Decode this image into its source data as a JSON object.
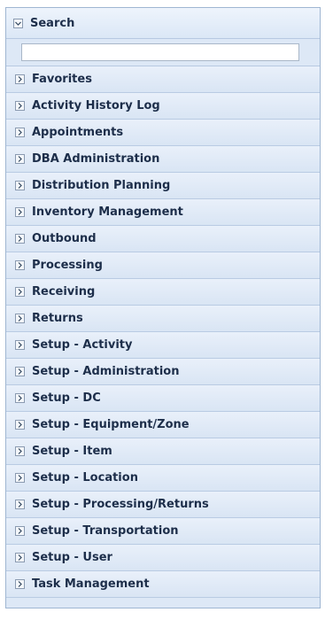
{
  "search": {
    "title": "Search",
    "input_value": "",
    "input_placeholder": ""
  },
  "menu": {
    "items": [
      {
        "label": "Favorites"
      },
      {
        "label": "Activity History Log"
      },
      {
        "label": "Appointments"
      },
      {
        "label": "DBA Administration"
      },
      {
        "label": "Distribution Planning"
      },
      {
        "label": "Inventory Management"
      },
      {
        "label": "Outbound"
      },
      {
        "label": "Processing"
      },
      {
        "label": "Receiving"
      },
      {
        "label": "Returns"
      },
      {
        "label": "Setup - Activity"
      },
      {
        "label": "Setup - Administration"
      },
      {
        "label": "Setup - DC"
      },
      {
        "label": "Setup - Equipment/Zone"
      },
      {
        "label": "Setup - Item"
      },
      {
        "label": "Setup - Location"
      },
      {
        "label": "Setup - Processing/Returns"
      },
      {
        "label": "Setup - Transportation"
      },
      {
        "label": "Setup - User"
      },
      {
        "label": "Task Management"
      }
    ],
    "expand_icon": "chevron-right-icon",
    "collapse_icon": "chevron-down-icon"
  }
}
